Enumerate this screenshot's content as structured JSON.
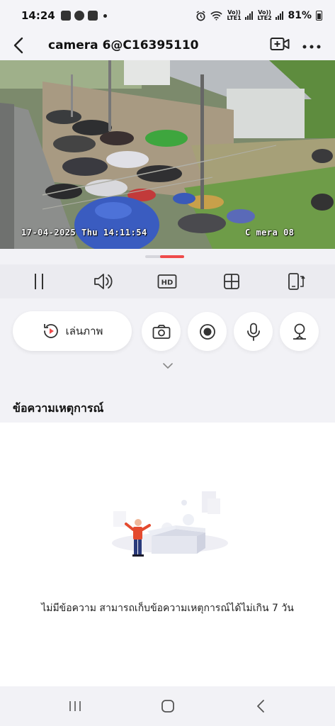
{
  "status_bar": {
    "time": "14:24",
    "battery": "81%",
    "sim1": "Vo)) LTE1",
    "sim2": "Vo)) LTE2",
    "icons": [
      "gallery-icon",
      "facebook-icon",
      "sigma-app-icon",
      "alarm-icon",
      "wifi-icon",
      "signal-icon",
      "battery-icon"
    ]
  },
  "header": {
    "title": "camera 6@C16395110",
    "icons": [
      "back-arrow-icon",
      "add-camera-icon",
      "more-icon"
    ]
  },
  "video": {
    "timestamp": "17-04-2025 Thu 14:11:54",
    "camera_label": "C mera 08"
  },
  "toolbar": {
    "items": [
      "pause-icon",
      "volume-icon",
      "hd-icon",
      "grid-icon",
      "rotate-screen-icon"
    ],
    "hd_label": "HD"
  },
  "controls": {
    "playback_label": "เล่นภาพ",
    "buttons": [
      "screenshot-icon",
      "record-icon",
      "microphone-icon",
      "ptz-icon"
    ]
  },
  "events": {
    "title": "ข้อความเหตุการณ์",
    "empty_text": "ไม่มีข้อความ สามารถเก็บข้อความเหตุการณ์ได้ไม่เกิน 7 วัน"
  },
  "nav": {
    "items": [
      "recent-apps-icon",
      "home-icon",
      "back-icon"
    ]
  },
  "colors": {
    "accent": "#ef4b4b",
    "background": "#f2f2f6",
    "toolbar": "#ebebf0"
  }
}
